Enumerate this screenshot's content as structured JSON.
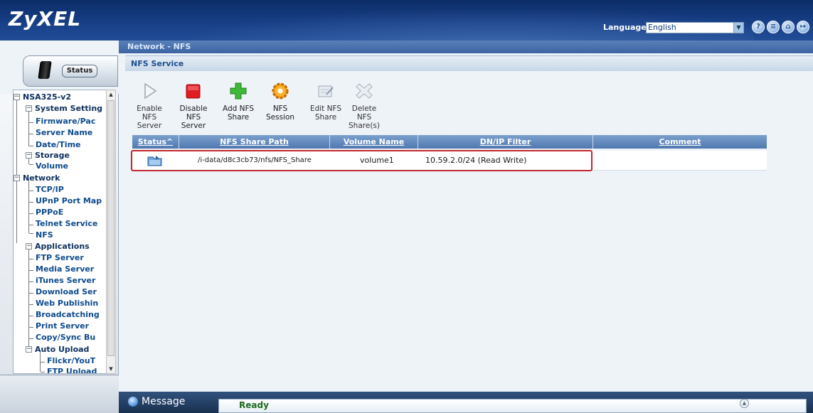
{
  "header": {
    "logo": "ZyXEL",
    "language_label": "Language:",
    "language_value": "English",
    "icons": [
      "help-icon",
      "sitemap-icon",
      "home-icon",
      "logout-icon"
    ]
  },
  "sidebar": {
    "status_tab": "Status",
    "tree": {
      "root": "NSA325-v2",
      "groups": [
        {
          "label": "System Setting",
          "items": [
            "Firmware/Pac",
            "Server Name",
            "Date/Time"
          ]
        },
        {
          "label": "Storage",
          "items": [
            "Volume"
          ]
        },
        {
          "label": "Network",
          "items": [
            "TCP/IP",
            "UPnP Port Map",
            "PPPoE",
            "Telnet Service",
            "NFS"
          ]
        },
        {
          "label": "Applications",
          "items": [
            "FTP Server",
            "Media Server",
            "iTunes Server",
            "Download Ser",
            "Web Publishin",
            "Broadcatching",
            "Print Server",
            "Copy/Sync Bu"
          ]
        },
        {
          "label": "Auto Upload",
          "items": [
            "Flickr/YouT",
            "FTP Upload"
          ]
        }
      ]
    }
  },
  "main": {
    "breadcrumb": "Network - NFS",
    "section_title": "NFS Service",
    "toolbar": [
      {
        "label": "Enable NFS Server",
        "icon": "play-icon"
      },
      {
        "label": "Disable NFS Server",
        "icon": "stop-icon"
      },
      {
        "label": "Add NFS Share",
        "icon": "add-icon"
      },
      {
        "label": "NFS Session",
        "icon": "gear-icon"
      },
      {
        "label": "Edit NFS Share",
        "icon": "edit-icon"
      },
      {
        "label": "Delete NFS Share(s)",
        "icon": "delete-icon"
      }
    ],
    "table": {
      "columns": [
        "Status^",
        "NFS Share Path",
        "Volume Name",
        "DN/IP Filter",
        "Comment"
      ],
      "rows": [
        {
          "status_icon": "share-icon",
          "path": "/i-data/d8c3cb73/nfs/NFS_Share",
          "volume": "volume1",
          "filter": "10.59.2.0/24 (Read Write)",
          "comment": ""
        }
      ]
    }
  },
  "message_bar": {
    "label": "Message",
    "text": "Ready"
  },
  "colors": {
    "header_bg": "#173f86",
    "highlight_border": "#c2272d",
    "table_header_bg": "#5a82b8",
    "status_ready": "#1a6a1a"
  }
}
